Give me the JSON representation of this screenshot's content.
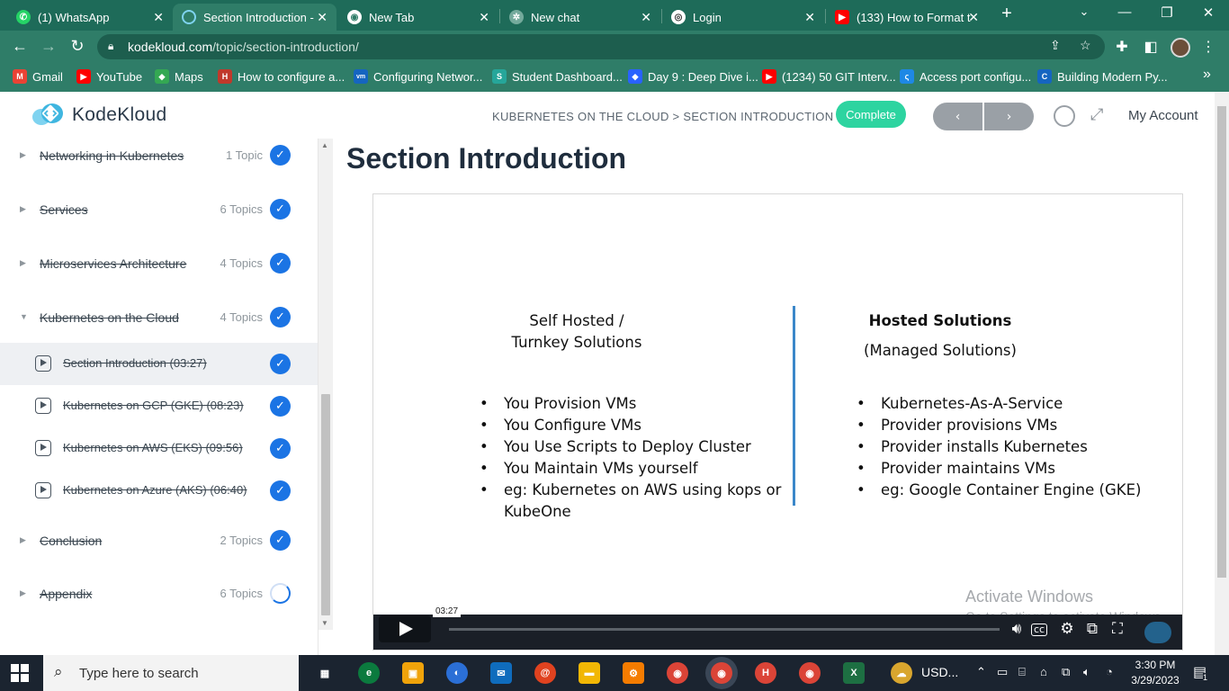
{
  "browser": {
    "tabs": [
      {
        "title": "(1) WhatsApp",
        "favicon": "whatsapp-icon",
        "color": "#25d366"
      },
      {
        "title": "Section Introduction -",
        "favicon": "kodekloud-icon",
        "color": "#3fb6e0"
      },
      {
        "title": "New Tab",
        "favicon": "chrome-icon",
        "color": "#ffffff"
      },
      {
        "title": "New chat",
        "favicon": "openai-icon",
        "color": "#74aa9c"
      },
      {
        "title": "Login",
        "favicon": "login-icon",
        "color": "#ffffff"
      },
      {
        "title": "(133) How to Format t",
        "favicon": "youtube-icon",
        "color": "#ff0000"
      }
    ],
    "url_host": "kodekloud.com",
    "url_path": "/topic/section-introduction/",
    "bookmarks": [
      {
        "label": "Gmail",
        "color": "#ea4335",
        "glyph": "M"
      },
      {
        "label": "YouTube",
        "color": "#ff0000",
        "glyph": "▶"
      },
      {
        "label": "Maps",
        "color": "#34a853",
        "glyph": "◆"
      },
      {
        "label": "How to configure a...",
        "color": "#c0392b",
        "glyph": "H"
      },
      {
        "label": "Configuring Networ...",
        "color": "#1565c0",
        "glyph": "vm"
      },
      {
        "label": "Student Dashboard...",
        "color": "#26a69a",
        "glyph": "S"
      },
      {
        "label": "Day 9 : Deep Dive i...",
        "color": "#2962ff",
        "glyph": "◆"
      },
      {
        "label": "(1234) 50 GIT Interv...",
        "color": "#ff0000",
        "glyph": "▶"
      },
      {
        "label": "Access port configu...",
        "color": "#1e88e5",
        "glyph": "ς"
      },
      {
        "label": "Building Modern Py...",
        "color": "#1565c0",
        "glyph": "C"
      }
    ],
    "more_bookmarks": "»"
  },
  "header": {
    "logo_text": "KodeKloud",
    "breadcrumb": "KUBERNETES ON THE CLOUD > SECTION INTRODUCTION",
    "complete_label": "Complete",
    "prev_label": "‹",
    "next_label": "›",
    "account_label": "My Account"
  },
  "sidebar": {
    "sections": [
      {
        "title": "Networking in Kubernetes",
        "count": "1 Topic",
        "status": "complete",
        "expanded": false
      },
      {
        "title": "Services",
        "count": "6 Topics",
        "status": "complete",
        "expanded": false
      },
      {
        "title": "Microservices Architecture",
        "count": "4 Topics",
        "status": "complete",
        "expanded": false
      },
      {
        "title": "Kubernetes on the Cloud",
        "count": "4 Topics",
        "status": "complete",
        "expanded": true
      }
    ],
    "lessons": [
      {
        "title": "Section Introduction (03:27)",
        "current": true
      },
      {
        "title": "Kubernetes on GCP (GKE) (08:23)",
        "current": false
      },
      {
        "title": "Kubernetes on AWS (EKS) (09:56)",
        "current": false
      },
      {
        "title": "Kubernetes on Azure (AKS) (06:40)",
        "current": false
      }
    ],
    "after_sections": [
      {
        "title": "Conclusion",
        "count": "2 Topics",
        "status": "complete"
      },
      {
        "title": "Appendix",
        "count": "6 Topics",
        "status": "in-progress"
      }
    ]
  },
  "main": {
    "title": "Section Introduction",
    "slide": {
      "left_title_1": "Self Hosted /",
      "left_title_2": "Turnkey Solutions",
      "left_items": [
        "You Provision VMs",
        "You Configure VMs",
        "You Use Scripts to Deploy Cluster",
        "You Maintain VMs yourself",
        "eg: Kubernetes on AWS using kops or KubeOne"
      ],
      "right_title_1": "Hosted Solutions",
      "right_title_2": "(Managed Solutions)",
      "right_items": [
        "Kubernetes-As-A-Service",
        "Provider provisions VMs",
        "Provider installs Kubernetes",
        "Provider maintains VMs",
        "eg: Google Container Engine (GKE)"
      ]
    },
    "player": {
      "time_tooltip": "03:27",
      "progress": 0.0
    },
    "watermark_line1": "Activate Windows",
    "watermark_line2": "Go to Settings to activate Windows."
  },
  "taskbar": {
    "search_placeholder": "Type here to search",
    "weather_label": "USD...",
    "time": "3:30 PM",
    "date": "3/29/2023",
    "notification_count": "1"
  }
}
